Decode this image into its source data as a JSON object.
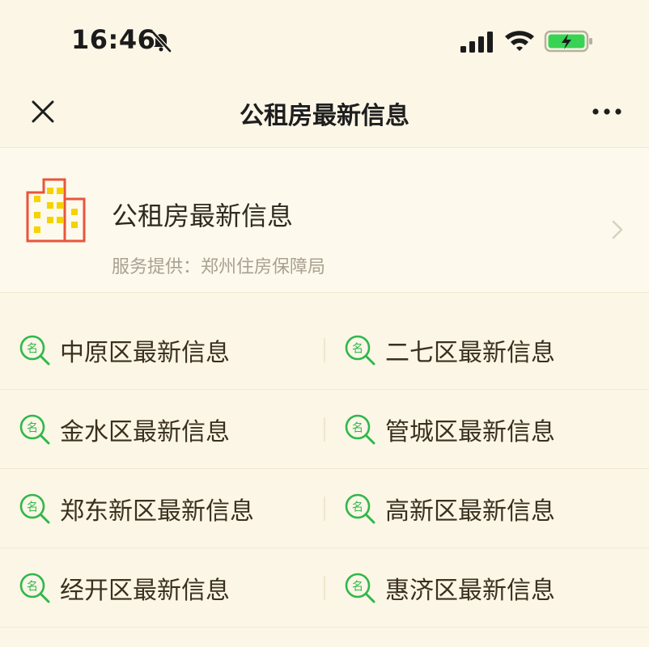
{
  "status_bar": {
    "time": "16:46",
    "icons": [
      "bell-slash-icon",
      "signal-icon",
      "wifi-icon",
      "battery-charging-icon"
    ]
  },
  "nav": {
    "title": "公租房最新信息",
    "icons": [
      "close-icon",
      "more-icon"
    ]
  },
  "service": {
    "name": "公租房最新信息",
    "provider": "服务提供：郑州住房保障局",
    "logo_icon": "building-icon"
  },
  "districts": [
    [
      "中原区最新信息",
      "二七区最新信息"
    ],
    [
      "金水区最新信息",
      "管城区最新信息"
    ],
    [
      "郑东新区最新信息",
      "高新区最新信息"
    ],
    [
      "经开区最新信息",
      "惠济区最新信息"
    ]
  ],
  "colors": {
    "background": "#fbf6e6",
    "accent_green": "#2fb84b",
    "building_red": "#e8553c",
    "building_yellow": "#f5d200",
    "battery_green": "#39d353"
  }
}
